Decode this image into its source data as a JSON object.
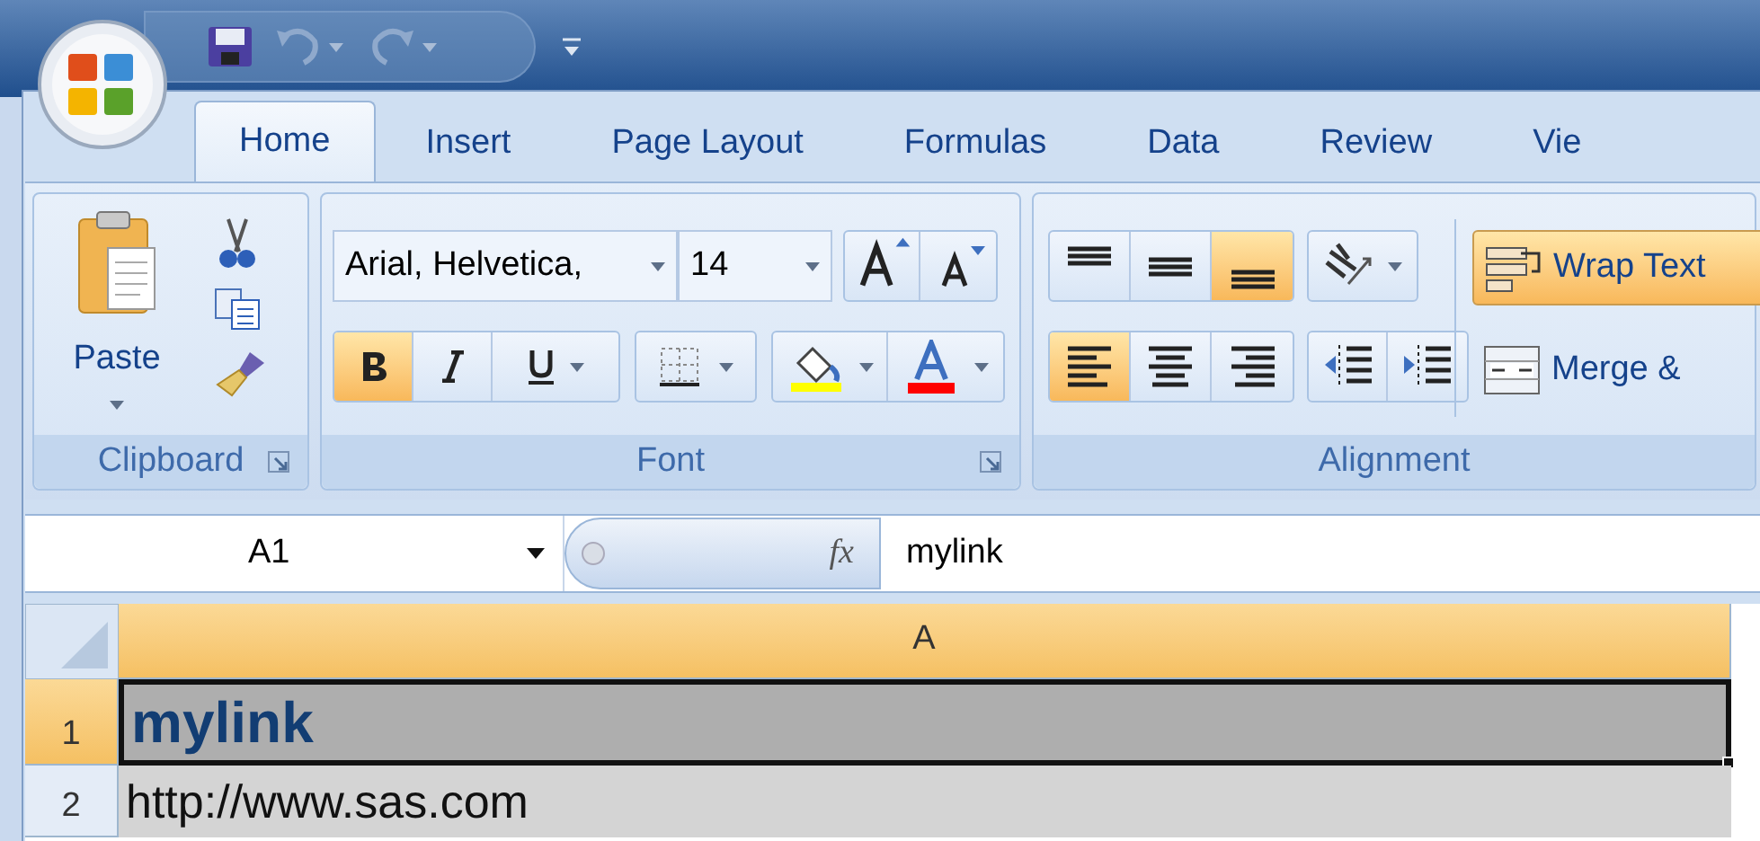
{
  "tabs": [
    {
      "label": "Home",
      "selected": true
    },
    {
      "label": "Insert",
      "selected": false
    },
    {
      "label": "Page Layout",
      "selected": false
    },
    {
      "label": "Formulas",
      "selected": false
    },
    {
      "label": "Data",
      "selected": false
    },
    {
      "label": "Review",
      "selected": false
    },
    {
      "label": "Vie",
      "selected": false
    }
  ],
  "clipboard": {
    "paste_label": "Paste",
    "group_label": "Clipboard"
  },
  "font": {
    "font_name": "Arial, Helvetica,",
    "font_size": "14",
    "bold": true,
    "italic": false,
    "underline": false,
    "group_label": "Font"
  },
  "alignment": {
    "vertical": [
      {
        "kind": "top",
        "selected": false
      },
      {
        "kind": "middle",
        "selected": false
      },
      {
        "kind": "bottom",
        "selected": true
      }
    ],
    "horizontal": [
      {
        "kind": "left",
        "selected": true
      },
      {
        "kind": "center",
        "selected": false
      },
      {
        "kind": "right",
        "selected": false
      }
    ],
    "wrap_text": {
      "label": "Wrap Text",
      "on": true
    },
    "merge": {
      "label": "Merge &"
    },
    "group_label": "Alignment"
  },
  "formula_bar": {
    "name_box": "A1",
    "fx": "fx",
    "content": "mylink"
  },
  "sheet": {
    "columns": [
      {
        "label": "A",
        "selected": true
      }
    ],
    "rows": [
      {
        "number": "1",
        "selected": true,
        "cells": [
          {
            "kind": "heading",
            "text": "mylink",
            "active": true
          }
        ]
      },
      {
        "number": "2",
        "selected": false,
        "cells": [
          {
            "kind": "plain",
            "text": "http://www.sas.com",
            "active": false
          }
        ]
      }
    ]
  }
}
